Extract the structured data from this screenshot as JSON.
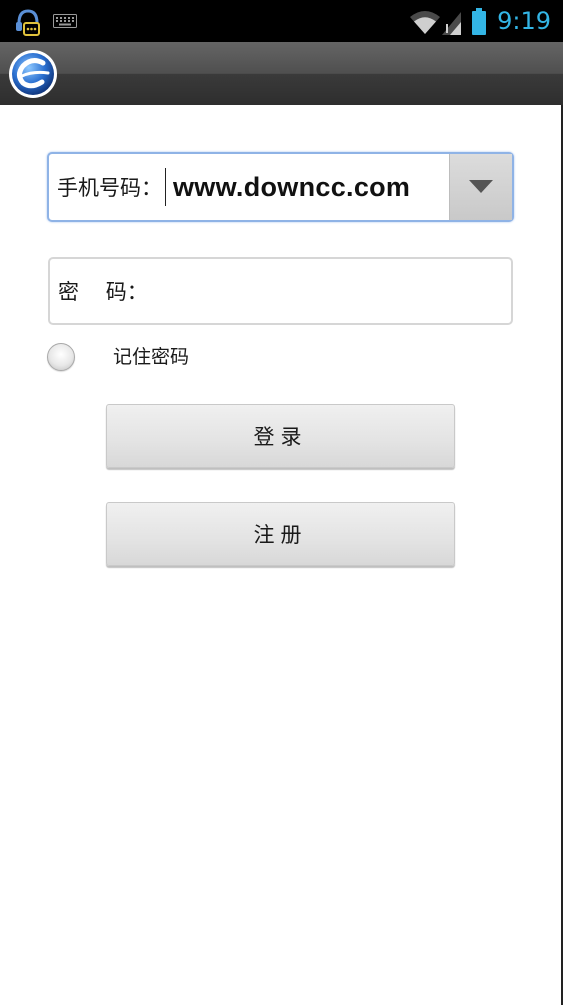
{
  "status_bar": {
    "time": "9:19",
    "icons": [
      "headset-notification-icon",
      "keyboard-icon",
      "wifi-icon",
      "signal-icon",
      "battery-icon"
    ],
    "time_color": "#33b5e5"
  },
  "app_bar": {
    "logo_icon": "app-logo-icon"
  },
  "login_form": {
    "phone_field": {
      "label": "手机号码：",
      "value": "www.downcc.com",
      "dropdown_icon": "dropdown-arrow-icon"
    },
    "password_field": {
      "label": "密    码：",
      "value": ""
    },
    "remember_password_label": "记住密码",
    "login_button_label": "登录",
    "register_button_label": "注册"
  },
  "colors": {
    "focus_border": "#8fb3e6",
    "background": "#ffffff"
  }
}
